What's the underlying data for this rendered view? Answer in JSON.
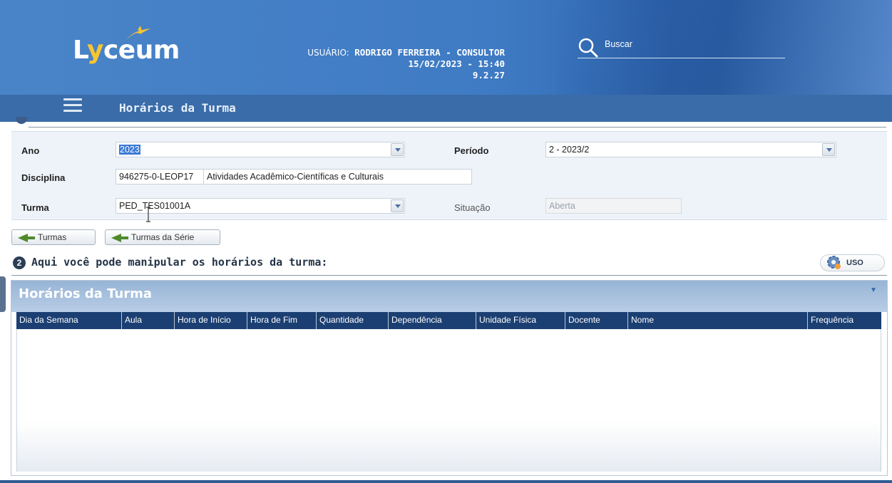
{
  "header": {
    "logo_text_l": "L",
    "logo_text_y": "y",
    "logo_text_rest": "ceum",
    "user_label": "USUÁRIO:",
    "user_name": "RODRIGO FERREIRA - CONSULTOR",
    "datetime": "15/02/2023 - 15:40",
    "version": "9.2.27",
    "search_placeholder": "Buscar"
  },
  "titlebar": {
    "title": "Horários da Turma"
  },
  "form": {
    "ano_label": "Ano",
    "ano_value": "2023",
    "periodo_label": "Período",
    "periodo_value": "2 - 2023/2",
    "disciplina_label": "Disciplina",
    "disciplina_code": "946275-0-LEOP17",
    "disciplina_name": "Atividades Acadêmico-Científicas e Culturais",
    "turma_label": "Turma",
    "turma_value": "PED_TES01001A",
    "situacao_label": "Situação",
    "situacao_value": "Aberta"
  },
  "buttons": {
    "turmas": "Turmas",
    "turmas_serie": "Turmas da Série",
    "uso": "USO"
  },
  "section2": {
    "step": "2",
    "title": "Aqui você pode manipular os horários da turma:"
  },
  "grid": {
    "title": "Horários da Turma",
    "columns": [
      "Dia da Semana",
      "Aula",
      "Hora de Início",
      "Hora de Fim",
      "Quantidade",
      "Dependência",
      "Unidade Física",
      "Docente",
      "Nome",
      "Frequência"
    ],
    "rows": []
  },
  "colors": {
    "header_blue": "#4a84c8",
    "titlebar_blue": "#3a6ca9",
    "grid_header_dark": "#1b3f72",
    "logo_yellow": "#f7c530"
  }
}
